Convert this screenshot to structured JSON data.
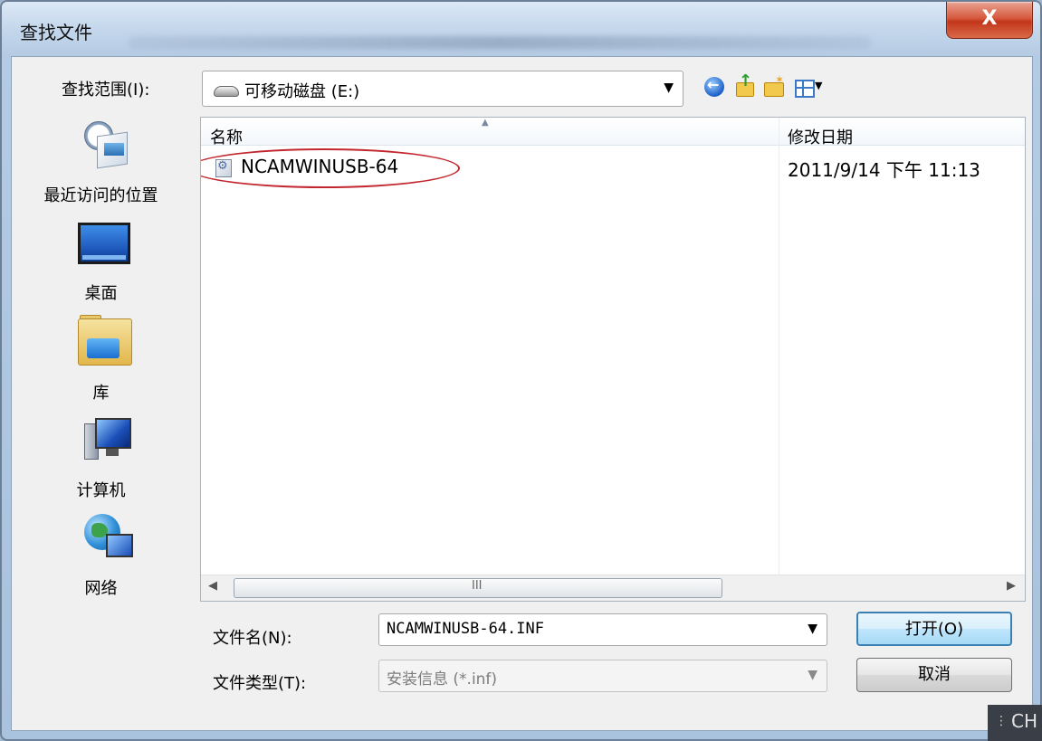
{
  "window": {
    "title": "查找文件",
    "close_label": "X"
  },
  "lookin": {
    "label": "查找范围(I):",
    "value": "可移动磁盘 (E:)"
  },
  "places": [
    {
      "label": "最近访问的位置"
    },
    {
      "label": "桌面"
    },
    {
      "label": "库"
    },
    {
      "label": "计算机"
    },
    {
      "label": "网络"
    }
  ],
  "filelist": {
    "columns": [
      "名称",
      "修改日期"
    ],
    "rows": [
      {
        "name": "NCAMWINUSB-64",
        "modified": "2011/9/14 下午 11:13"
      }
    ],
    "scroll_grip": "III"
  },
  "filename": {
    "label": "文件名(N):",
    "value": "NCAMWINUSB-64.INF"
  },
  "filetype": {
    "label": "文件类型(T):",
    "value": "安装信息 (*.inf)"
  },
  "buttons": {
    "open": "打开(O)",
    "cancel": "取消"
  },
  "ime": {
    "label": "CH"
  },
  "colors": {
    "highlight_ellipse": "#c2262e",
    "open_button_border": "#3c7fb1"
  }
}
